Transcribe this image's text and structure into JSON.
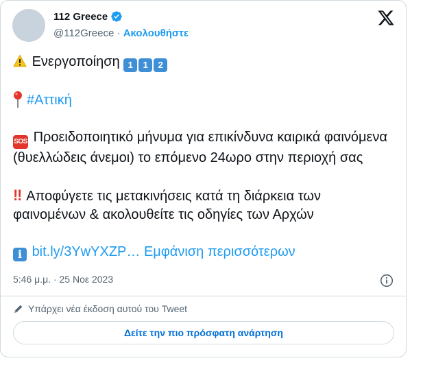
{
  "tweet": {
    "display_name": "112 Greece",
    "handle": "@112Greece",
    "separator": "·",
    "follow_label": "Ακολουθήστε",
    "verified_icon": "verified-badge-icon",
    "lines": {
      "activation": "Ενεργοποίηση",
      "activation_digits": [
        "1",
        "1",
        "2"
      ],
      "hashtag": "#Αττική",
      "sos_label": "SOS",
      "warning": "Προειδοποιητικό μήνυμα για επικίνδυνα καιρικά φαινόμενα (θυελλώδεις άνεμοι) το επόμενο 24ωρο στην περιοχή σας",
      "advice_mark": "‼",
      "advice": "Αποφύγετε τις μετακινήσεις κατά τη διάρκεια των φαινομένων & ακολουθείτε τις οδηγίες των Αρχών",
      "info_mark": "i",
      "link": "bit.ly/3YwYXZP…",
      "show_more": "Εμφάνιση περισσότερων"
    },
    "timestamp": "5:46 μ.μ. · 25 Νοε 2023",
    "edit_notice": "Υπάρχει νέα έκδοση αυτού του Tweet",
    "view_latest_label": "Δείτε την πιο πρόσφατη ανάρτηση"
  },
  "colors": {
    "accent": "#1d9bf0",
    "button_text": "#006fd6",
    "muted": "#536471",
    "border": "#cfd9de",
    "emoji_blue": "#3e8fd6",
    "emoji_red": "#e2352b"
  }
}
